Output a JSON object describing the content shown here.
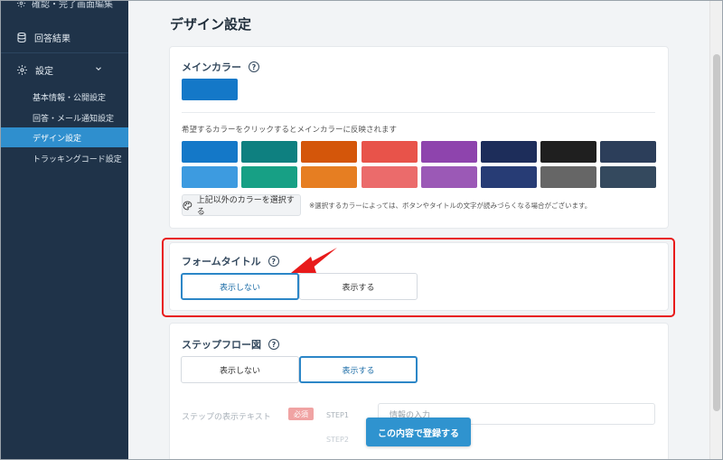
{
  "sidebar": {
    "top_item": "確認・完了画面編集",
    "answer_results": "回答結果",
    "settings": "設定",
    "sub_items": [
      "基本情報・公開設定",
      "回答・メール通知設定",
      "デザイン設定",
      "トラッキングコード設定"
    ],
    "active_index": 2
  },
  "page_title": "デザイン設定",
  "main_color": {
    "title": "メインカラー",
    "help": "?",
    "selected_color": "#1478c8",
    "hint": "希望するカラーをクリックするとメインカラーに反映されます",
    "palette_row1": [
      "#1478c8",
      "#0e8080",
      "#d4560a",
      "#e8534a",
      "#8e44ad",
      "#1d2d5a",
      "#1f1f1f",
      "#2c3e5a"
    ],
    "palette_row2": [
      "#3d9be0",
      "#17a085",
      "#e67e22",
      "#eb6b6b",
      "#9b59b6",
      "#273c75",
      "#666666",
      "#34495e"
    ],
    "custom_button": "上記以外のカラーを選択する",
    "note": "※選択するカラーによっては、ボタンやタイトルの文字が読みづらくなる場合がございます。"
  },
  "form_title": {
    "title": "フォームタイトル",
    "help": "?",
    "hide_label": "表示しない",
    "show_label": "表示する",
    "selected": "hide"
  },
  "step_flow": {
    "title": "ステップフロー図",
    "help": "?",
    "hide_label": "表示しない",
    "show_label": "表示する",
    "selected": "show",
    "text_label": "ステップの表示テキスト",
    "required_badge": "必須",
    "step1": "STEP1",
    "step2": "STEP2",
    "step1_value": "情報の入力"
  },
  "register_button": "この内容で登録する",
  "colors": {
    "sidebar_bg": "#1f3349",
    "active_item": "#2f8fce",
    "highlight": "#e81a1a",
    "primary_button": "#2f93cf"
  }
}
